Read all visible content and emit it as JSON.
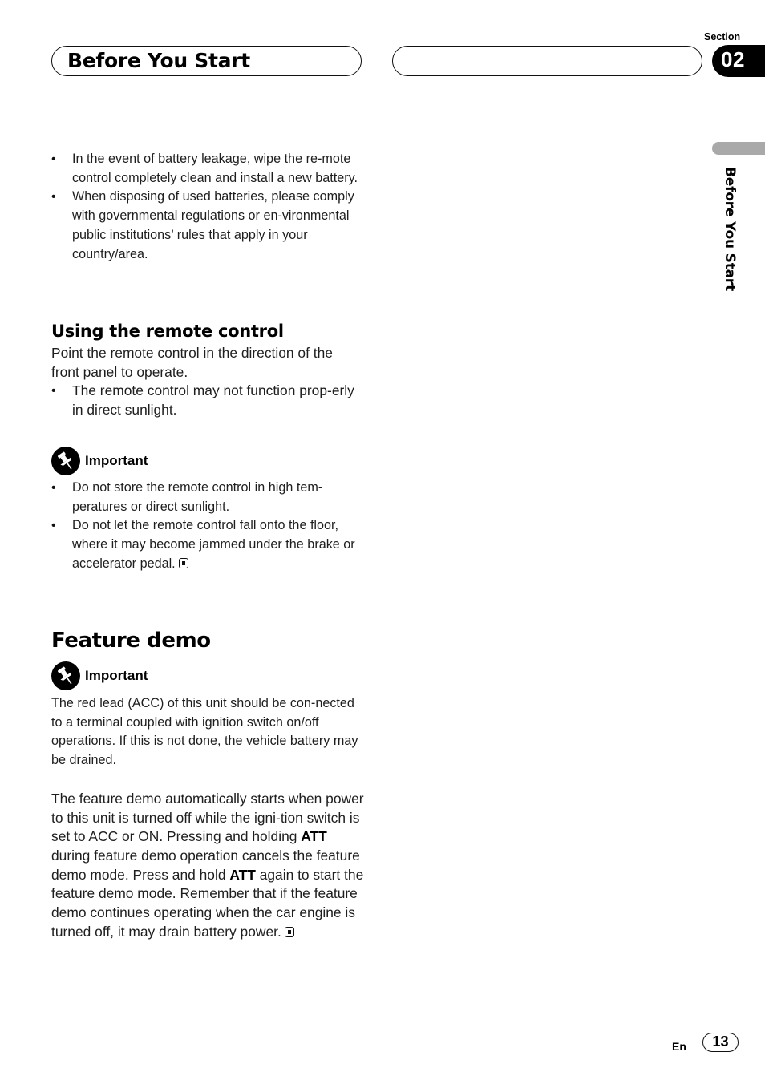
{
  "header": {
    "title": "Before You Start",
    "right_title": "",
    "section_label": "Section",
    "section_number": "02"
  },
  "side_tab": {
    "label": "Before You Start"
  },
  "battery_notes": {
    "items": [
      "In the event of battery leakage, wipe the re-mote control completely clean and install a new battery.",
      "When disposing of used batteries, please comply with governmental regulations or en-vironmental public institutions’ rules that apply in your country/area."
    ]
  },
  "remote_section": {
    "heading": "Using the remote control",
    "intro": "Point the remote control in the direction of the front panel to operate.",
    "items": [
      "The remote control may not function prop-erly in direct sunlight."
    ],
    "important": {
      "icon": "pushpin-icon",
      "label": "Important",
      "items": [
        "Do not store the remote control in high tem-peratures or direct sunlight.",
        "Do not let the remote control fall onto the floor, where it may become jammed under the brake or accelerator pedal."
      ]
    }
  },
  "feature_demo": {
    "heading": "Feature demo",
    "important": {
      "icon": "pushpin-icon",
      "label": "Important",
      "text": "The red lead (ACC) of this unit should be con-nected to a terminal coupled with ignition switch on/off operations. If this is not done, the vehicle battery may be drained."
    },
    "para": {
      "p1": "The feature demo automatically starts when power to this unit is turned off while the igni-tion switch is set to ACC or ON. Pressing and holding ",
      "kw1": "ATT",
      "p2": " during feature demo operation cancels the feature demo mode. Press and hold ",
      "kw2": "ATT",
      "p3": " again to start the feature demo mode. Remember that if the feature demo continues operating when the car engine is turned off, it may drain battery power."
    }
  },
  "footer": {
    "language": "En",
    "page_number": "13"
  }
}
